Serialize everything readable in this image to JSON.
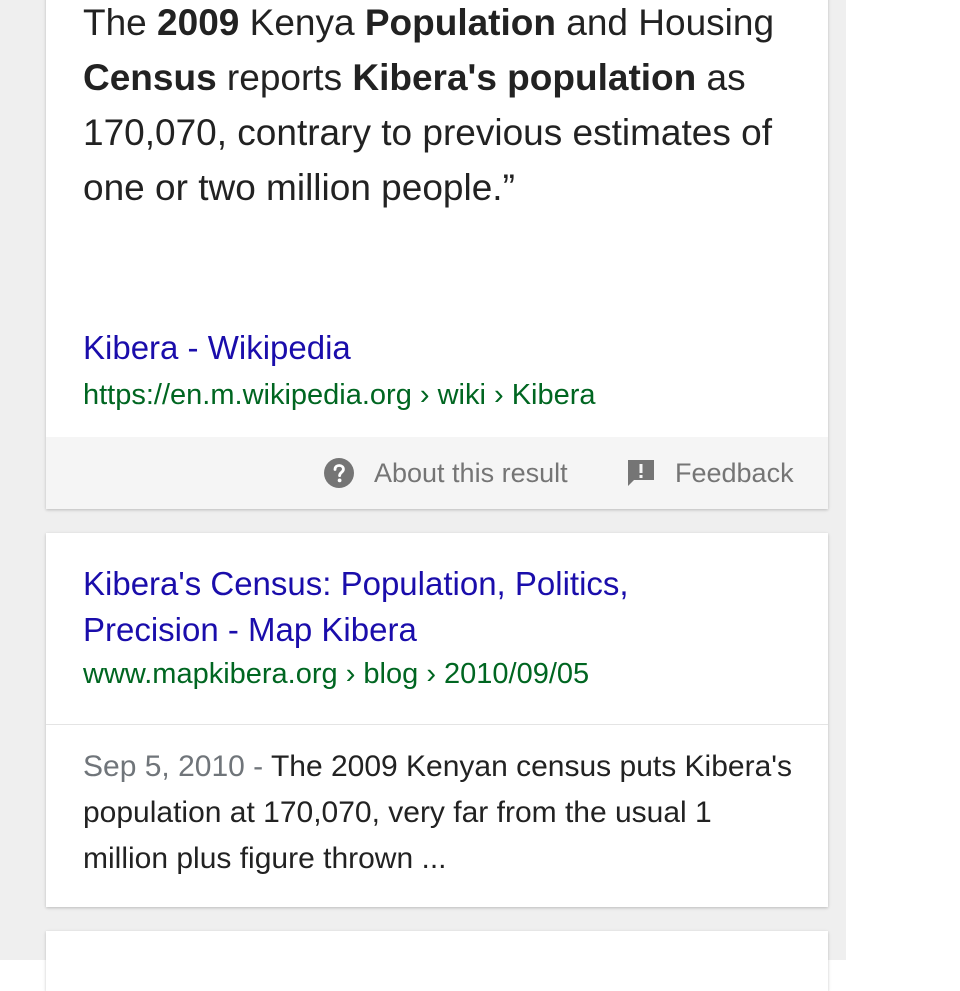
{
  "result1": {
    "snippet_parts": [
      {
        "text": "The ",
        "bold": false
      },
      {
        "text": "2009",
        "bold": true
      },
      {
        "text": " Kenya ",
        "bold": false
      },
      {
        "text": "Population",
        "bold": true
      },
      {
        "text": " and Housing ",
        "bold": false
      },
      {
        "text": "Census",
        "bold": true
      },
      {
        "text": " reports ",
        "bold": false
      },
      {
        "text": "Kibera's population",
        "bold": true
      },
      {
        "text": " as 170,070, contrary to previous estimates of one or two million people.”",
        "bold": false
      }
    ],
    "title": "Kibera - Wikipedia",
    "url": "https://en.m.wikipedia.org › wiki › Kibera",
    "about_label": "About this result",
    "feedback_label": "Feedback",
    "about_icon": "question-circle-icon",
    "feedback_icon": "feedback-icon"
  },
  "result2": {
    "title_line1": "Kibera's Census: Population, Politics,",
    "title_line2": "Precision - Map Kibera",
    "url": "www.mapkibera.org › blog › 2010/09/05",
    "date": "Sep 5, 2010 - ",
    "description": "The 2009 Kenyan census puts Kibera's population at 170,070, very far from the usual 1 million plus figure thrown ..."
  },
  "colors": {
    "link": "#1a0dab",
    "url": "#006621",
    "text": "#222222",
    "muted": "#757575",
    "background": "#efefef"
  }
}
